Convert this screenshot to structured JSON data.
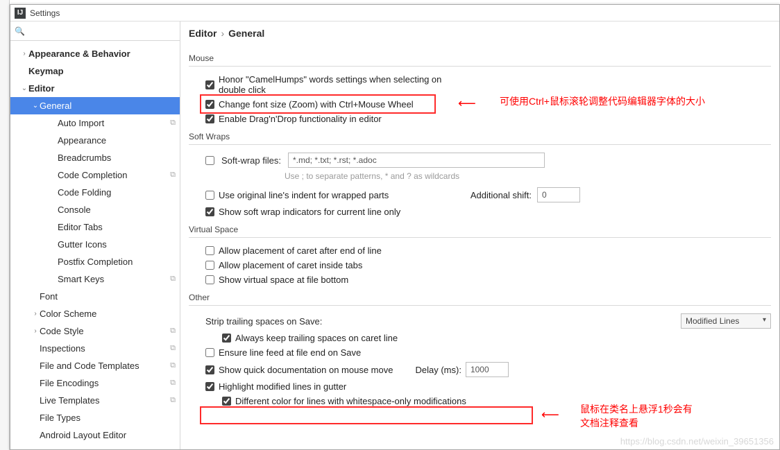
{
  "window": {
    "title": "Settings",
    "app_icon_letter": "IJ"
  },
  "search": {
    "placeholder": ""
  },
  "sidebar": {
    "items": [
      {
        "label": "Appearance & Behavior",
        "depth": 0,
        "chev": "›",
        "bold": true
      },
      {
        "label": "Keymap",
        "depth": 0,
        "chev": "",
        "bold": true
      },
      {
        "label": "Editor",
        "depth": 0,
        "chev": "⌄",
        "bold": true
      },
      {
        "label": "General",
        "depth": 1,
        "chev": "⌄",
        "bold": false,
        "selected": true
      },
      {
        "label": "Auto Import",
        "depth": 2,
        "copy": true
      },
      {
        "label": "Appearance",
        "depth": 2
      },
      {
        "label": "Breadcrumbs",
        "depth": 2
      },
      {
        "label": "Code Completion",
        "depth": 2,
        "copy": true
      },
      {
        "label": "Code Folding",
        "depth": 2
      },
      {
        "label": "Console",
        "depth": 2
      },
      {
        "label": "Editor Tabs",
        "depth": 2
      },
      {
        "label": "Gutter Icons",
        "depth": 2
      },
      {
        "label": "Postfix Completion",
        "depth": 2
      },
      {
        "label": "Smart Keys",
        "depth": 2,
        "copy": true
      },
      {
        "label": "Font",
        "depth": 1
      },
      {
        "label": "Color Scheme",
        "depth": 1,
        "chev": "›"
      },
      {
        "label": "Code Style",
        "depth": 1,
        "chev": "›",
        "copy": true
      },
      {
        "label": "Inspections",
        "depth": 1,
        "copy": true
      },
      {
        "label": "File and Code Templates",
        "depth": 1,
        "copy": true
      },
      {
        "label": "File Encodings",
        "depth": 1,
        "copy": true
      },
      {
        "label": "Live Templates",
        "depth": 1,
        "copy": true
      },
      {
        "label": "File Types",
        "depth": 1
      },
      {
        "label": "Android Layout Editor",
        "depth": 1
      }
    ]
  },
  "breadcrumb": {
    "a": "Editor",
    "sep": "›",
    "b": "General"
  },
  "sections": {
    "mouse": {
      "title": "Mouse",
      "honor": "Honor \"CamelHumps\" words settings when selecting on double click",
      "zoom": "Change font size (Zoom) with Ctrl+Mouse Wheel",
      "dnd": "Enable Drag'n'Drop functionality in editor"
    },
    "softwraps": {
      "title": "Soft Wraps",
      "filesLabel": "Soft-wrap files:",
      "filesValue": "*.md; *.txt; *.rst; *.adoc",
      "hint": "Use ; to separate patterns, * and ? as wildcards",
      "useOrig": "Use original line's indent for wrapped parts",
      "addShiftLabel": "Additional shift:",
      "addShiftValue": "0",
      "showInd": "Show soft wrap indicators for current line only"
    },
    "vspace": {
      "title": "Virtual Space",
      "afterEol": "Allow placement of caret after end of line",
      "insideTabs": "Allow placement of caret inside tabs",
      "bottom": "Show virtual space at file bottom"
    },
    "other": {
      "title": "Other",
      "stripLabel": "Strip trailing spaces on Save:",
      "stripValue": "Modified Lines",
      "keepCaret": "Always keep trailing spaces on caret line",
      "ensureLF": "Ensure line feed at file end on Save",
      "quickDoc": "Show quick documentation on mouse move",
      "delayLabel": "Delay (ms):",
      "delayValue": "1000",
      "highlight": "Highlight modified lines in gutter",
      "diffColor": "Different color for lines with whitespace-only modifications"
    }
  },
  "annotations": {
    "note1": "可使用Ctrl+鼠标滚轮调整代码编辑器字体的大小",
    "note2a": "鼠标在类名上悬浮1秒会有",
    "note2b": "文档注释查看",
    "arrow": "⟵"
  },
  "watermark": "https://blog.csdn.net/weixin_39651356"
}
